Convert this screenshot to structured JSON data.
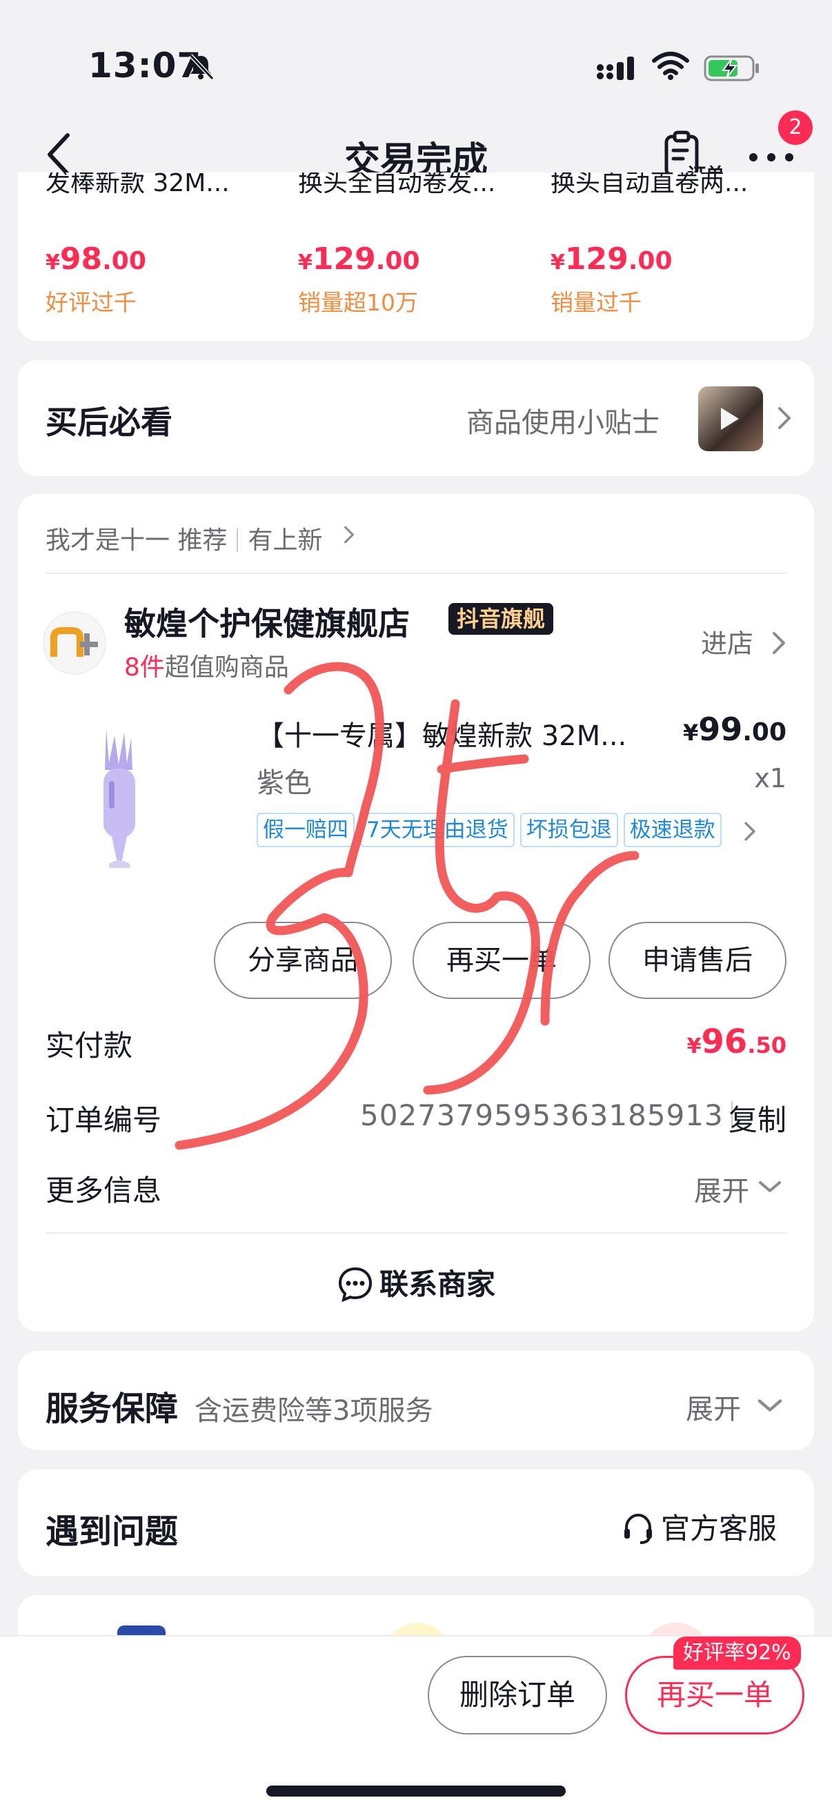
{
  "status_bar": {
    "time": "13:07"
  },
  "nav": {
    "title": "交易完成",
    "order_label": "订单",
    "more_badge": "2"
  },
  "recommendations": [
    {
      "name": "发棒新款 32M...",
      "price_currency": "¥",
      "price_int": "98",
      "price_dec": ".00",
      "tag": "好评过千"
    },
    {
      "name": "换头全自动卷发...",
      "price_currency": "¥",
      "price_int": "129",
      "price_dec": ".00",
      "tag": "销量超10万"
    },
    {
      "name": "换头自动直卷两...",
      "price_currency": "¥",
      "price_int": "129",
      "price_dec": ".00",
      "tag": "销量过千"
    }
  ],
  "must_see": {
    "title": "买后必看",
    "tip": "商品使用小贴士"
  },
  "order": {
    "recommended_by": "我才是十一 推荐",
    "new_arrivals": "有上新",
    "shop_name": "敏煌个护保健旗舰店",
    "shop_badge": "抖音旗舰",
    "shop_sub_num": "8件",
    "shop_sub_text": "超值购商品",
    "enter_shop": "进店",
    "product_title": "【十一专属】敏煌新款 32M...",
    "price_currency": "¥",
    "price_int": "99",
    "price_dec": ".00",
    "spec": "紫色",
    "qty": "x1",
    "tags": [
      "假一赔四",
      "7天无理由退货",
      "坏损包退",
      "极速退款"
    ],
    "btn_share": "分享商品",
    "btn_rebuy": "再买一单",
    "btn_aftersale": "申请售后",
    "paid_label": "实付款",
    "paid_currency": "¥",
    "paid_int": "96",
    "paid_dec": ".50",
    "order_no_label": "订单编号",
    "order_no": "5027379595363185913",
    "copy": "复制",
    "more_info_label": "更多信息",
    "expand": "展开",
    "contact": "联系商家"
  },
  "service": {
    "title": "服务保障",
    "sub": "含运费险等3项服务",
    "expand": "展开"
  },
  "problem": {
    "title": "遇到问题",
    "cs": "官方客服"
  },
  "bottom": {
    "delete": "删除订单",
    "rebuy": "再买一单",
    "rate_badge": "好评率92%"
  },
  "overlay": {
    "handwritten": "35r"
  },
  "colors": {
    "accent": "#fe2c55",
    "orange_tag": "#f28c3e",
    "tag_blue": "#1f8ad9",
    "scribble": "#f25555"
  }
}
